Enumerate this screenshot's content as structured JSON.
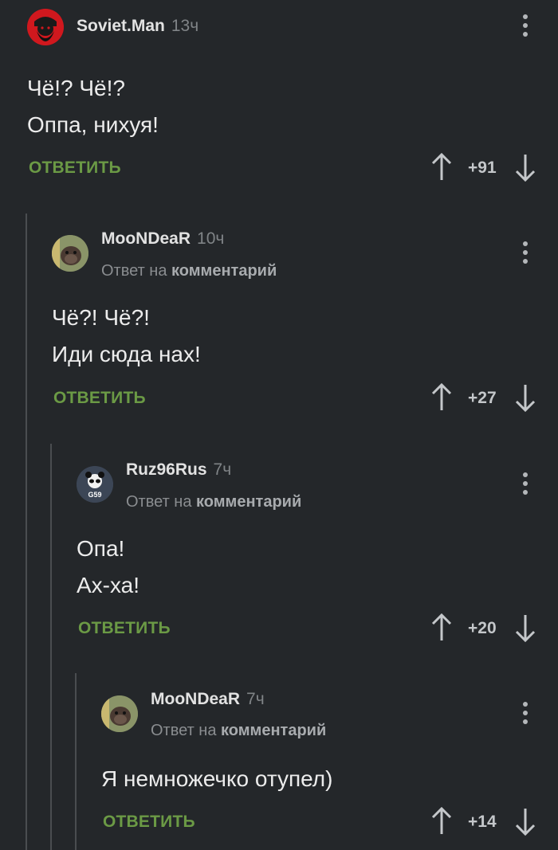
{
  "comments": [
    {
      "author": "Soviet.Man",
      "time": "13ч",
      "reply_prefix": "",
      "reply_target": "",
      "lines": [
        "Чё!? Чё!?",
        "Оппа, нихуя!"
      ],
      "reply_label": "ОТВЕТИТЬ",
      "rating": "+91",
      "avatar_icon": "bearded-man-avatar-icon"
    },
    {
      "author": "MooNDeaR",
      "time": "10ч",
      "reply_prefix": "Ответ на",
      "reply_target": "комментарий",
      "lines": [
        "Чё?! Чё?!",
        "Иди сюда нах!"
      ],
      "reply_label": "ОТВЕТИТЬ",
      "rating": "+27",
      "avatar_icon": "hamster-avatar-icon"
    },
    {
      "author": "Ruz96Rus",
      "time": "7ч",
      "reply_prefix": "Ответ на",
      "reply_target": "комментарий",
      "lines": [
        "Опа!",
        "Ах-ха!"
      ],
      "reply_label": "ОТВЕТИТЬ",
      "rating": "+20",
      "avatar_icon": "panda-avatar-icon",
      "avatar_text": "G59"
    },
    {
      "author": "MooNDeaR",
      "time": "7ч",
      "reply_prefix": "Ответ на",
      "reply_target": "комментарий",
      "lines": [
        "Я немножечко отупел)"
      ],
      "reply_label": "ОТВЕТИТЬ",
      "rating": "+14",
      "avatar_icon": "hamster-avatar-icon"
    }
  ],
  "colors": {
    "background": "#24272a",
    "reply_green": "#6b9a45",
    "thread_line": "#4a4d50"
  }
}
